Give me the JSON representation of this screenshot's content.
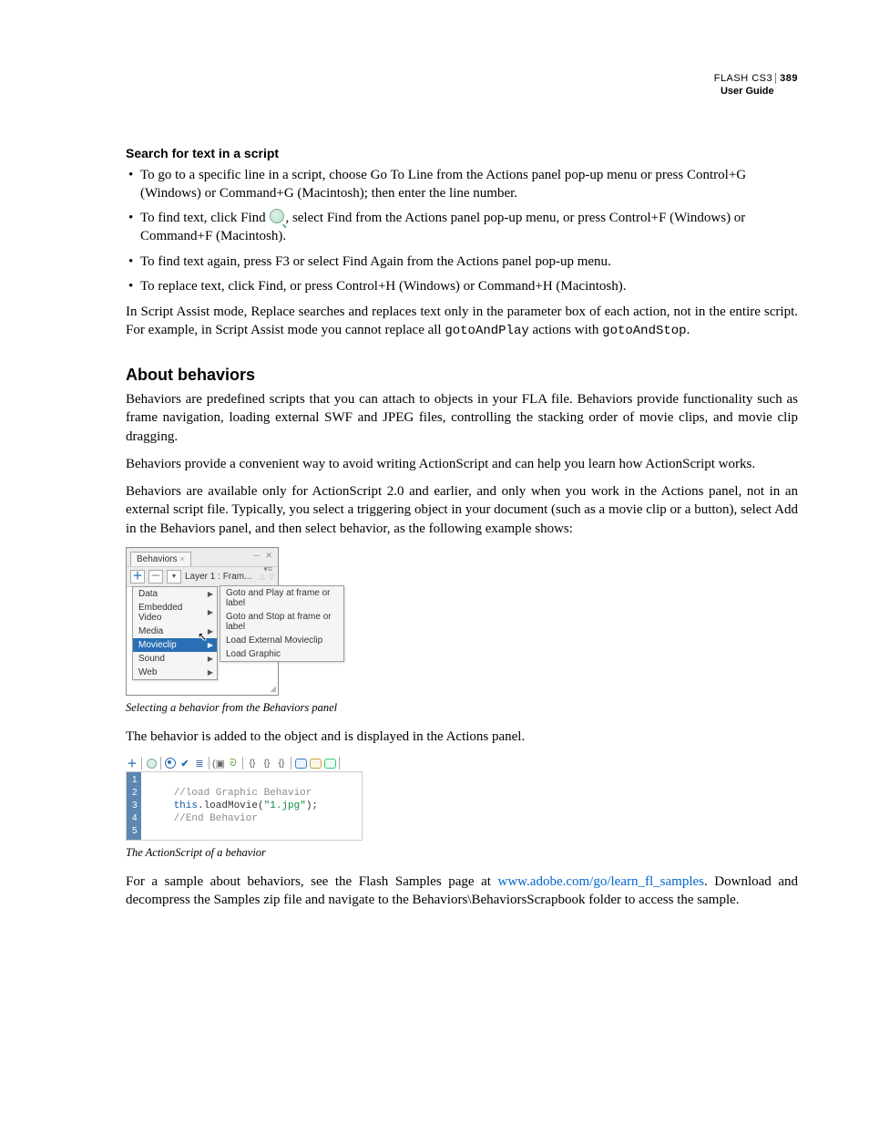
{
  "header": {
    "product": "FLASH CS3",
    "page_number": "389",
    "subtitle": "User Guide"
  },
  "section1": {
    "heading": "Search for text in a script",
    "bullets": {
      "b1": "To go to a specific line in a script, choose Go To Line from the Actions panel pop-up menu or press Control+G (Windows) or Command+G (Macintosh); then enter the line number.",
      "b2a": "To find text, click Find ",
      "b2b": ", select Find from the Actions panel pop-up menu, or press Control+F (Windows) or Command+F (Macintosh).",
      "b3": "To find text again, press F3 or select Find Again from the Actions panel pop-up menu.",
      "b4": "To replace text, click Find, or press Control+H (Windows) or Command+H (Macintosh)."
    },
    "para1a": "In Script Assist mode, Replace searches and replaces text only in the parameter box of each action, not in the entire script. For example, in Script Assist mode you cannot replace all ",
    "code1": "gotoAndPlay",
    "para1b": " actions with ",
    "code2": "gotoAndStop",
    "para1c": "."
  },
  "section2": {
    "heading": "About behaviors",
    "p1": "Behaviors are predefined scripts that you can attach to objects in your FLA file. Behaviors provide functionality such as frame navigation, loading external SWF and JPEG files, controlling the stacking order of movie clips, and movie clip dragging.",
    "p2": "Behaviors provide a convenient way to avoid writing ActionScript and can help you learn how ActionScript works.",
    "p3": "Behaviors are available only for ActionScript 2.0 and earlier, and only when you work in the Actions panel, not in an external script file. Typically, you select a triggering object in your document (such as a movie clip or a button), select Add in the Behaviors panel, and then select behavior, as the following example shows:",
    "caption1": "Selecting a behavior from the Behaviors panel",
    "p4": "The behavior is added to the object and is displayed in the Actions panel.",
    "caption2": "The ActionScript of a behavior",
    "p5a": "For a sample about behaviors, see the Flash Samples page at ",
    "link": "www.adobe.com/go/learn_fl_samples",
    "p5b": ". Download and decompress the Samples zip file and navigate to the Behaviors\\BehaviorsScrapbook folder to access the sample."
  },
  "panel": {
    "tab": "Behaviors",
    "toolbar_label": "Layer 1 : Fram...",
    "menu": [
      "Data",
      "Embedded Video",
      "Media",
      "Movieclip",
      "Sound",
      "Web"
    ],
    "selected_index": 3,
    "submenu": [
      "Goto and Play at frame or label",
      "Goto and Stop at frame or label",
      "Load External Movieclip",
      "Load Graphic"
    ]
  },
  "editor": {
    "gutter": [
      "1",
      "2",
      "3",
      "4",
      "5"
    ],
    "comment1": "//load Graphic Behavior",
    "kw": "this",
    "method": ".loadMovie(",
    "str": "\"1.jpg\"",
    "tail": ");",
    "comment2": "//End Behavior"
  }
}
